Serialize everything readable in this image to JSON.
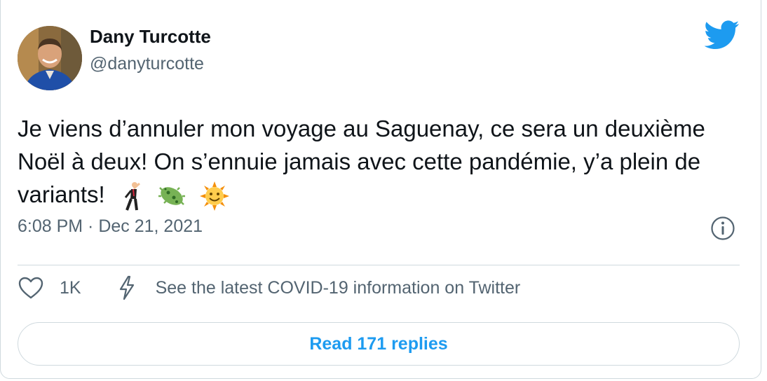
{
  "author": {
    "name": "Dany Turcotte",
    "handle": "@danyturcotte"
  },
  "tweet": {
    "text": "Je viens d’annuler mon voyage au Saguenay, ce sera un deuxième Noël à deux! On s’ennuie jamais avec cette pandémie, y’a plein de variants!",
    "emojis": [
      "🕺",
      "🦠",
      "🌞"
    ],
    "timestamp": "6:08 PM · Dec 21, 2021"
  },
  "actions": {
    "like_count": "1K",
    "covid_info": "See the latest COVID-19 information on Twitter"
  },
  "replies_button": "Read 171 replies",
  "icons": {
    "brand": "twitter-bird-icon",
    "info": "info-icon",
    "like": "heart-icon",
    "covid": "lightning-bolt-icon"
  },
  "colors": {
    "brand_blue": "#1d9bf0",
    "secondary_text": "#536471",
    "border": "#cfd9de"
  }
}
